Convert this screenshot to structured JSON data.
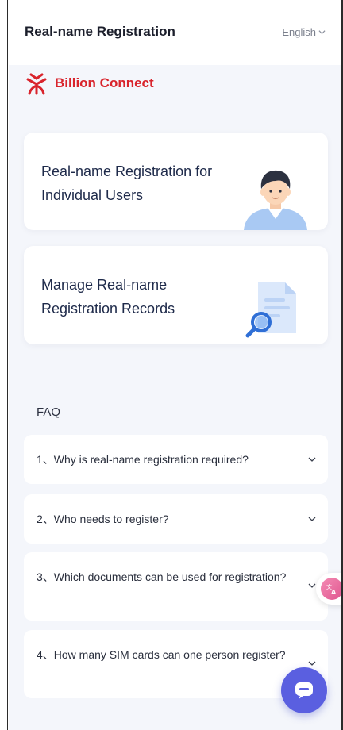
{
  "header": {
    "title": "Real-name Registration",
    "language": "English"
  },
  "brand": {
    "name": "Billion Connect",
    "color": "#d9242c"
  },
  "cards": [
    {
      "label_line1": "Real-name Registration for",
      "label_line2": "Individual Users",
      "icon": "user-avatar-icon"
    },
    {
      "label_line1": "Manage Real-name",
      "label_line2": "Registration Records",
      "icon": "document-search-icon"
    }
  ],
  "faq": {
    "title": "FAQ",
    "items": [
      {
        "question": "1、Why is real-name registration required?"
      },
      {
        "question": "2、Who needs to register?"
      },
      {
        "question": "3、Which documents can be used for registration?"
      },
      {
        "question": "4、How many SIM cards can one person register?"
      }
    ]
  },
  "colors": {
    "accent": "#5a5fe0",
    "background": "#f4f6fb"
  }
}
